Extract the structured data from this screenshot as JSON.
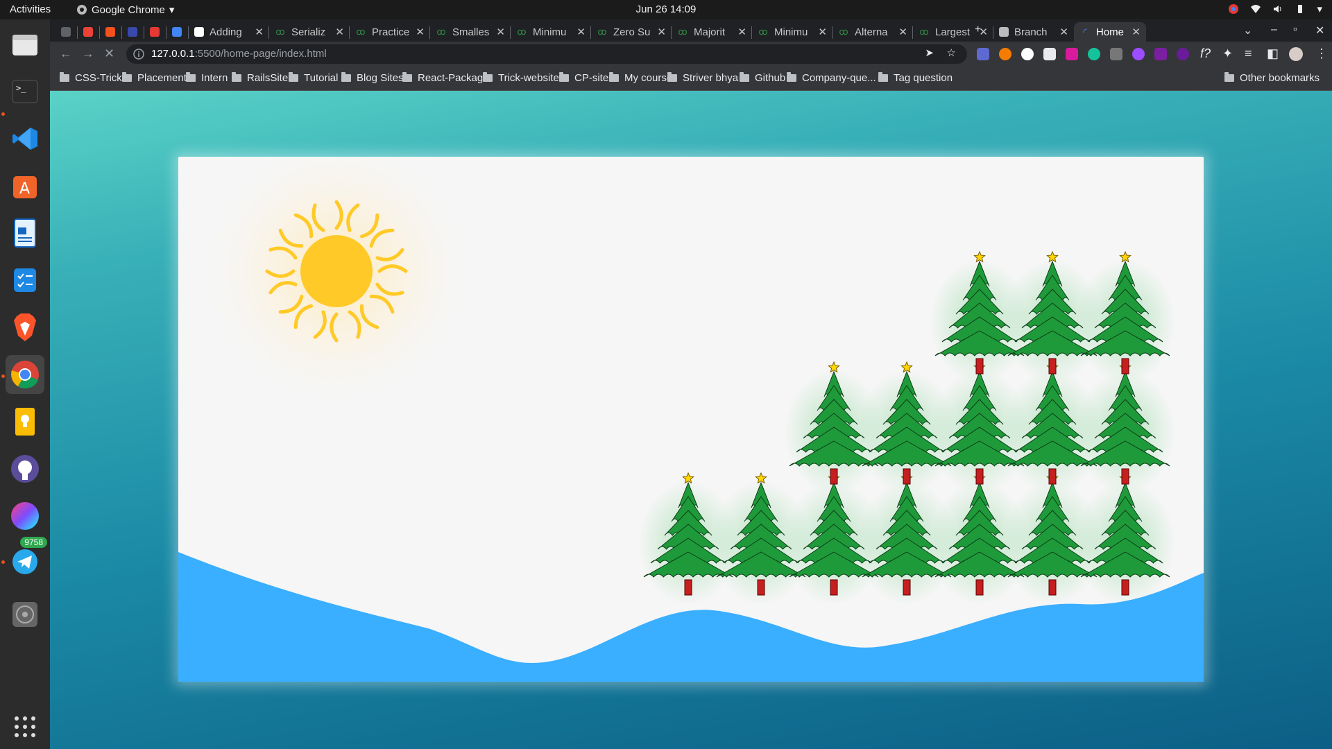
{
  "topbar": {
    "activities": "Activities",
    "app_name": "Google Chrome",
    "clock": "Jun 26  14:09"
  },
  "dock": {
    "items": [
      "files-icon",
      "terminal-icon",
      "vscode-icon",
      "software-center-icon",
      "writer-icon",
      "tasks-icon",
      "brave-icon",
      "chrome-icon",
      "notes-icon",
      "github-icon",
      "color-app-icon",
      "telegram-icon",
      "disc-icon"
    ],
    "telegram_badge": "9758"
  },
  "tabs": [
    {
      "label": "",
      "icon": "link-icon"
    },
    {
      "label": "",
      "icon": "gmail-icon"
    },
    {
      "label": "",
      "icon": "e-icon"
    },
    {
      "label": "",
      "icon": "c-icon"
    },
    {
      "label": "",
      "icon": "red-icon"
    },
    {
      "label": "",
      "icon": "docs-icon"
    },
    {
      "label": "Adding",
      "icon": "geek-icon"
    },
    {
      "label": "Serializ",
      "icon": "gfg-icon"
    },
    {
      "label": "Practice",
      "icon": "gfg-icon"
    },
    {
      "label": "Smalles",
      "icon": "gfg-icon"
    },
    {
      "label": "Minimu",
      "icon": "gfg-icon"
    },
    {
      "label": "Zero Su",
      "icon": "gfg-icon"
    },
    {
      "label": "Majorit",
      "icon": "gfg-icon"
    },
    {
      "label": "Minimu",
      "icon": "gfg-icon"
    },
    {
      "label": "Alterna",
      "icon": "gfg-icon"
    },
    {
      "label": "Largest",
      "icon": "gfg-icon"
    },
    {
      "label": "Branch",
      "icon": "github-icon"
    },
    {
      "label": "Home",
      "icon": "loading-icon"
    }
  ],
  "address": {
    "host": "127.0.0.1",
    "path": ":5500/home-page/index.html"
  },
  "bookmarks": [
    "CSS-Tricks",
    "Placement",
    "Intern",
    "RailsSite",
    "Tutorial",
    "Blog Sites",
    "React-Package",
    "Trick-website",
    "CP-sites",
    "My course",
    "Striver bhya",
    "Github",
    "Company-que...",
    "Tag question"
  ],
  "other_bookmarks": "Other bookmarks",
  "colors": {
    "sun": "#ffca28",
    "tree": "#1f9a3a",
    "trunk": "#c61f1f",
    "star": "#ffd600",
    "wave": "#3aaeff",
    "gfg": "#2f8d46"
  }
}
